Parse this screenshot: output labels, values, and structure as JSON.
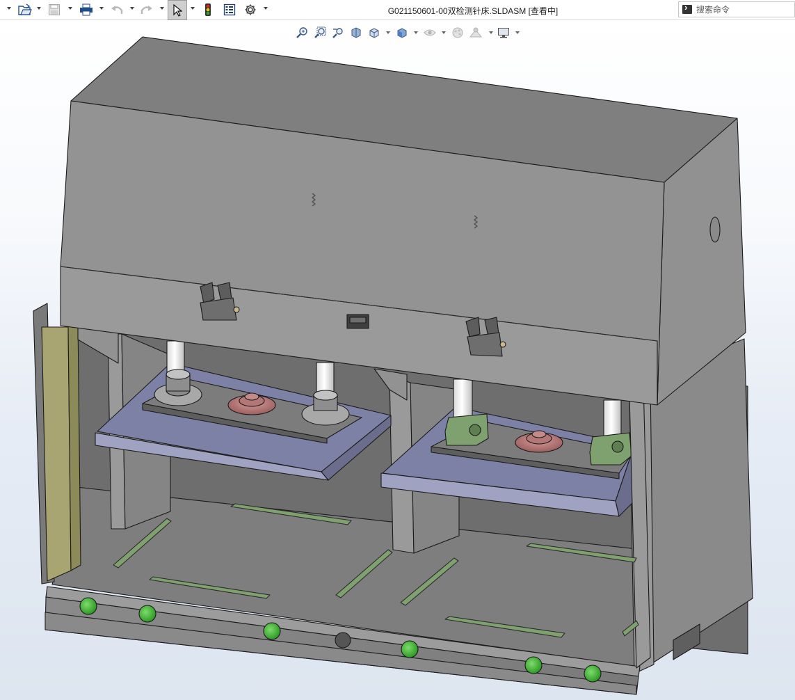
{
  "titlebar": {
    "document_title": "G021150601-00双检测针床.SLDASM [查看中]",
    "tools": [
      {
        "name": "new-icon",
        "has_dropdown": true
      },
      {
        "name": "open-icon",
        "has_dropdown": true
      },
      {
        "name": "save-icon",
        "has_dropdown": true,
        "disabled": true
      },
      {
        "name": "print-icon",
        "has_dropdown": true
      },
      {
        "name": "undo-icon",
        "has_dropdown": true,
        "disabled": true
      },
      {
        "name": "redo-icon",
        "has_dropdown": true,
        "disabled": true
      },
      {
        "name": "select-icon",
        "has_dropdown": true,
        "active": true
      },
      {
        "name": "rebuild-icon",
        "has_dropdown": false
      },
      {
        "name": "file-properties-icon",
        "has_dropdown": false
      },
      {
        "name": "options-icon",
        "has_dropdown": true
      }
    ]
  },
  "search": {
    "placeholder": "搜索命令",
    "value": ""
  },
  "heads_up_toolbar": {
    "tools": [
      {
        "name": "zoom-to-fit-icon",
        "has_dropdown": false
      },
      {
        "name": "zoom-to-area-icon",
        "has_dropdown": false
      },
      {
        "name": "previous-view-icon",
        "has_dropdown": false
      },
      {
        "name": "section-view-icon",
        "has_dropdown": false
      },
      {
        "name": "view-orientation-icon",
        "has_dropdown": true
      },
      {
        "name": "display-style-icon",
        "has_dropdown": true
      },
      {
        "name": "hide-show-items-icon",
        "has_dropdown": true
      },
      {
        "name": "edit-appearance-icon",
        "has_dropdown": false
      },
      {
        "name": "apply-scene-icon",
        "has_dropdown": true
      },
      {
        "name": "view-settings-icon",
        "has_dropdown": true
      }
    ]
  },
  "colors": {
    "sheet_metal": "#8e8e8e",
    "plate_blue": "#7c80a4",
    "green_parts": "#7fa06f",
    "flange_red": "#b07474",
    "button_green": "#4caf3c",
    "side_rail": "#9b9b62"
  }
}
